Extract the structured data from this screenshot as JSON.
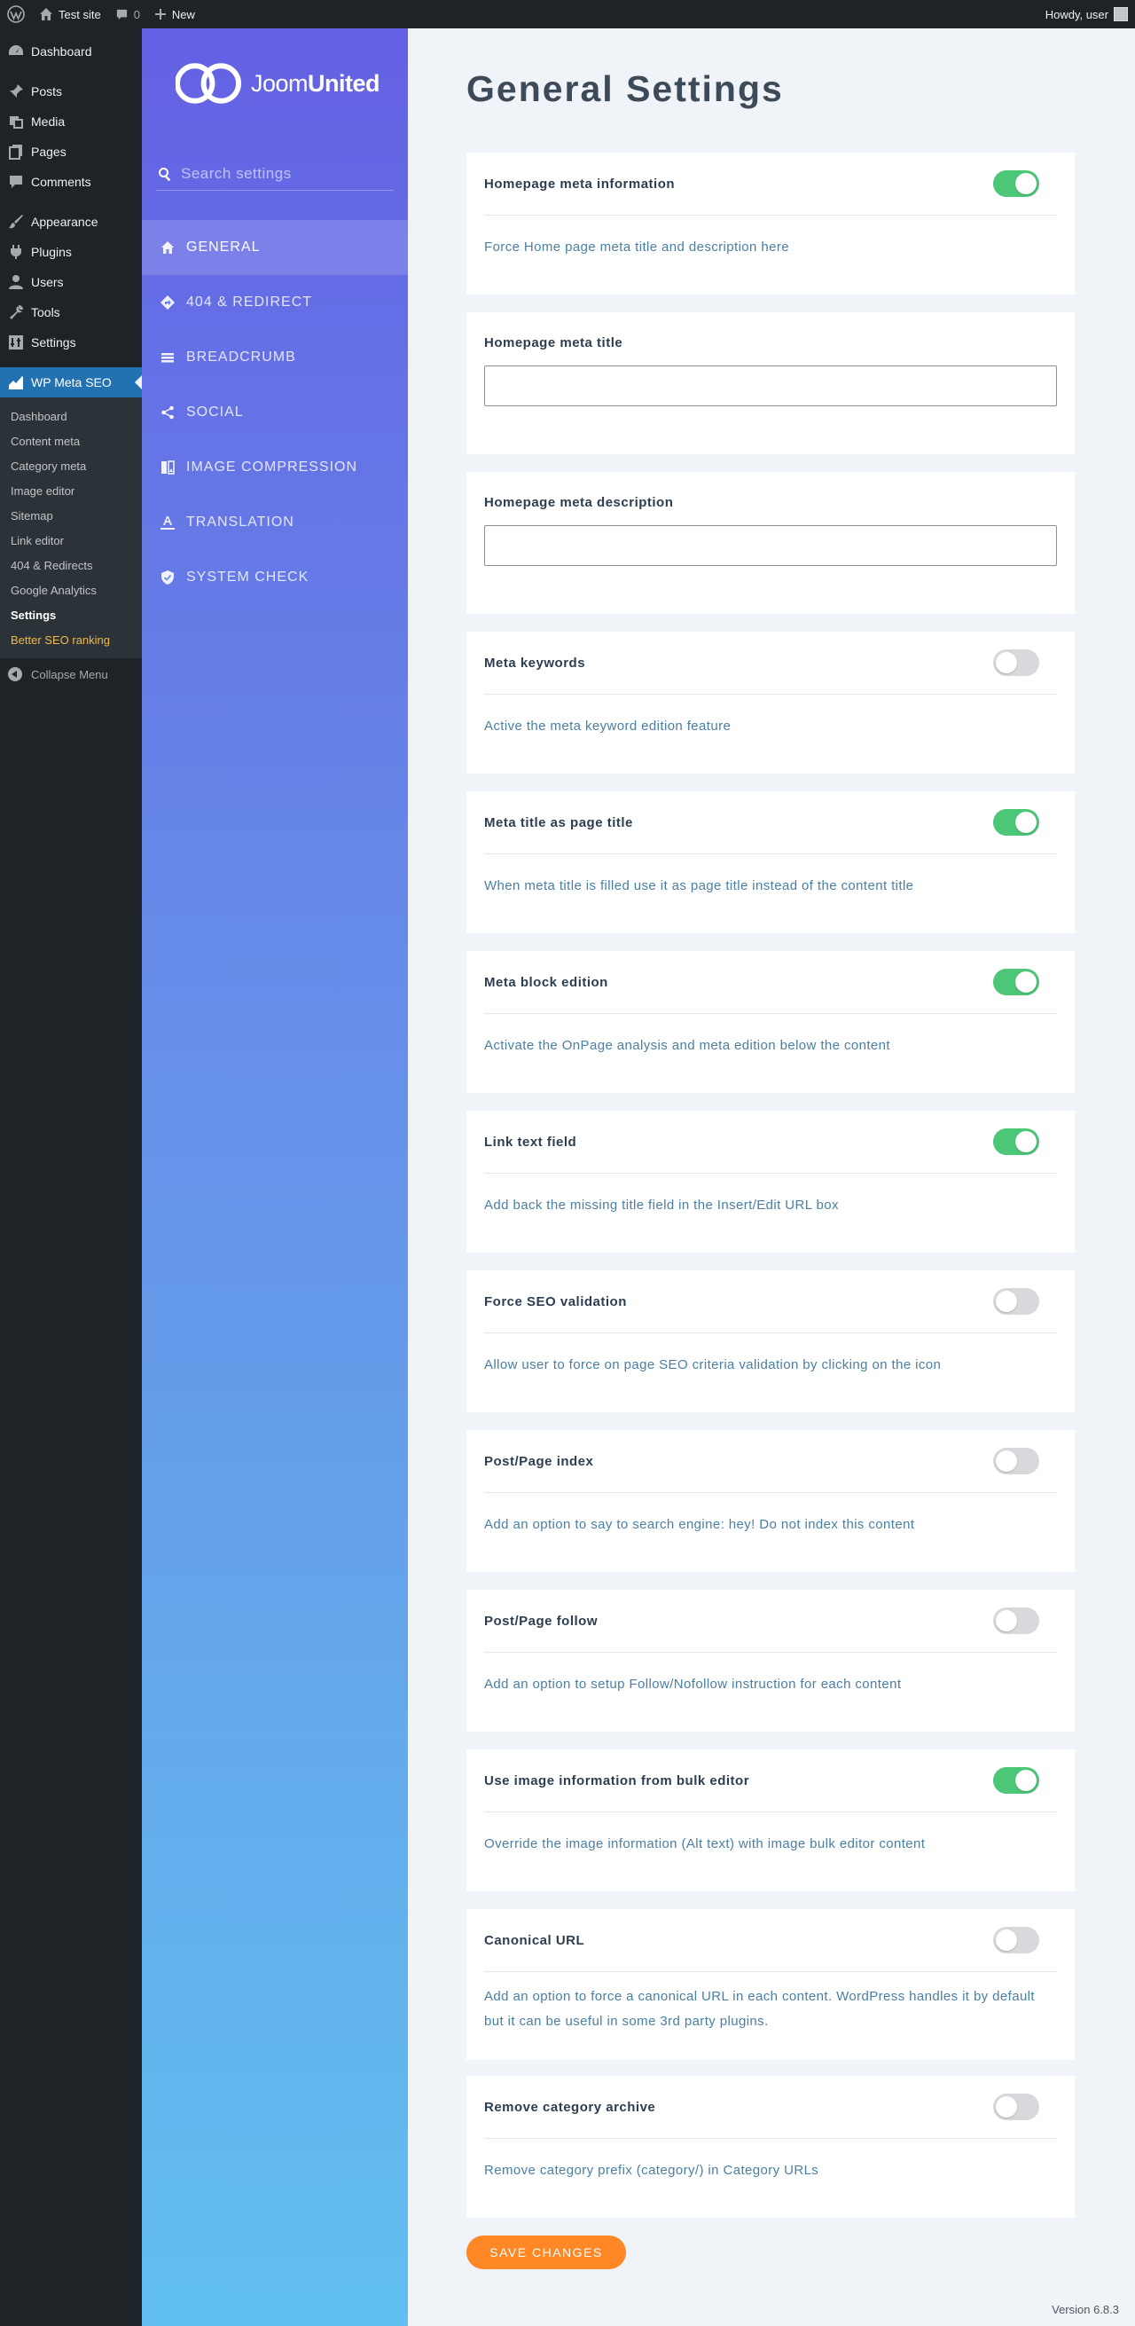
{
  "adminbar": {
    "site_name": "Test site",
    "comments_count": "0",
    "new_label": "New",
    "howdy": "Howdy, user"
  },
  "adminmenu": {
    "items_top": [
      {
        "label": "Dashboard",
        "icon": "dashboard-icon"
      }
    ],
    "items_content": [
      {
        "label": "Posts",
        "icon": "pin-icon"
      },
      {
        "label": "Media",
        "icon": "media-icon"
      },
      {
        "label": "Pages",
        "icon": "pages-icon"
      },
      {
        "label": "Comments",
        "icon": "comments-icon"
      }
    ],
    "items_admin": [
      {
        "label": "Appearance",
        "icon": "brush-icon"
      },
      {
        "label": "Plugins",
        "icon": "plug-icon"
      },
      {
        "label": "Users",
        "icon": "user-icon"
      },
      {
        "label": "Tools",
        "icon": "wrench-icon"
      },
      {
        "label": "Settings",
        "icon": "sliders-icon"
      }
    ],
    "current": {
      "label": "WP Meta SEO",
      "icon": "chart-icon"
    },
    "submenu": [
      "Dashboard",
      "Content meta",
      "Category meta",
      "Image editor",
      "Sitemap",
      "Link editor",
      "404 & Redirects",
      "Google Analytics",
      "Settings",
      "Better SEO ranking"
    ],
    "active_submenu": "Settings",
    "promo_submenu": "Better SEO ranking",
    "collapse_label": "Collapse Menu"
  },
  "plugin_nav": {
    "logo_text_light": "Joom",
    "logo_text_bold": "United",
    "search_placeholder": "Search settings",
    "items": [
      {
        "label": "GENERAL",
        "icon": "home-icon"
      },
      {
        "label": "404 & REDIRECT",
        "icon": "redirect-icon"
      },
      {
        "label": "BREADCRUMB",
        "icon": "breadcrumb-icon"
      },
      {
        "label": "SOCIAL",
        "icon": "share-icon"
      },
      {
        "label": "IMAGE COMPRESSION",
        "icon": "image-compression-icon"
      },
      {
        "label": "TRANSLATION",
        "icon": "translation-icon"
      },
      {
        "label": "SYSTEM CHECK",
        "icon": "shield-icon"
      }
    ],
    "active": "GENERAL"
  },
  "main": {
    "title": "General Settings",
    "settings": [
      {
        "type": "toggle",
        "title": "Homepage meta information",
        "description": "Force Home page meta title and description here",
        "on": true
      },
      {
        "type": "input",
        "title": "Homepage meta title",
        "value": ""
      },
      {
        "type": "input",
        "title": "Homepage meta description",
        "value": ""
      },
      {
        "type": "toggle",
        "title": "Meta keywords",
        "description": "Active the meta keyword edition feature",
        "on": false
      },
      {
        "type": "toggle",
        "title": "Meta title as page title",
        "description": "When meta title is filled use it as page title instead of the content title",
        "on": true
      },
      {
        "type": "toggle",
        "title": "Meta block edition",
        "description": "Activate the OnPage analysis and meta edition below the content",
        "on": true
      },
      {
        "type": "toggle",
        "title": "Link text field",
        "description": "Add back the missing title field in the Insert/Edit URL box",
        "on": true
      },
      {
        "type": "toggle",
        "title": "Force SEO validation",
        "description": "Allow user to force on page SEO criteria validation by clicking on the icon",
        "on": false
      },
      {
        "type": "toggle",
        "title": "Post/Page index",
        "description": "Add an option to say to search engine: hey! Do not index this content",
        "on": false
      },
      {
        "type": "toggle",
        "title": "Post/Page follow",
        "description": "Add an option to setup Follow/Nofollow instruction for each content",
        "on": false
      },
      {
        "type": "toggle",
        "title": "Use image information from bulk editor",
        "description": "Override the image information (Alt text) with image bulk editor content",
        "on": true
      },
      {
        "type": "toggle",
        "title": "Canonical URL",
        "description": "Add an option to force a canonical URL in each content. WordPress handles it by default but it can be useful in some 3rd party plugins.",
        "on": false
      },
      {
        "type": "toggle",
        "title": "Remove category archive",
        "description": "Remove category prefix (category/) in Category URLs",
        "on": false
      }
    ],
    "save_label": "SAVE CHANGES",
    "version": "Version 6.8.3"
  },
  "colors": {
    "toggle_on": "#4cc777",
    "toggle_off": "#d7d9dc",
    "save_button": "#ff8726",
    "admin_current": "#2271b1"
  }
}
